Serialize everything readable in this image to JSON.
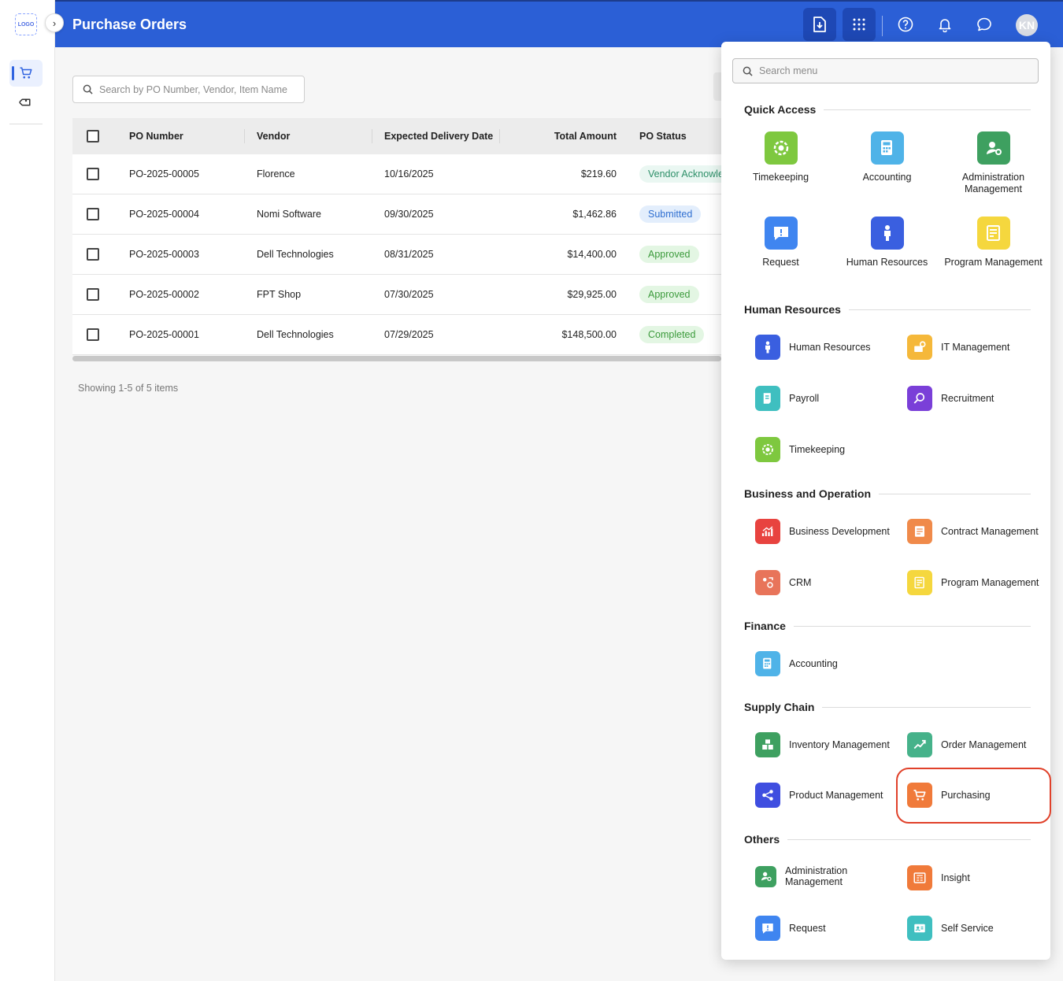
{
  "app": {
    "logo_text": "LOGO",
    "page_title": "Purchase Orders",
    "user_initials": "KN"
  },
  "icons": {
    "cart": "shopping-cart-icon",
    "tag": "tag-icon",
    "download": "download-icon",
    "apps": "apps-grid-icon",
    "help": "help-icon",
    "bell": "bell-icon",
    "chat": "chat-icon",
    "search": "search-icon"
  },
  "colors": {
    "brand_blue": "#2b5fd6",
    "highlight": "#e0412a"
  },
  "search": {
    "placeholder": "Search by PO Number, Vendor, Item Name"
  },
  "table": {
    "headers": {
      "po": "PO Number",
      "vendor": "Vendor",
      "date": "Expected Delivery Date",
      "total": "Total Amount",
      "status": "PO Status"
    },
    "rows": [
      {
        "po": "PO-2025-00005",
        "vendor": "Florence",
        "date": "10/16/2025",
        "total": "$219.60",
        "status": "Vendor Acknowledged"
      },
      {
        "po": "PO-2025-00004",
        "vendor": "Nomi Software",
        "date": "09/30/2025",
        "total": "$1,462.86",
        "status": "Submitted"
      },
      {
        "po": "PO-2025-00003",
        "vendor": "Dell Technologies",
        "date": "08/31/2025",
        "total": "$14,400.00",
        "status": "Approved"
      },
      {
        "po": "PO-2025-00002",
        "vendor": "FPT Shop",
        "date": "07/30/2025",
        "total": "$29,925.00",
        "status": "Approved"
      },
      {
        "po": "PO-2025-00001",
        "vendor": "Dell Technologies",
        "date": "07/29/2025",
        "total": "$148,500.00",
        "status": "Completed"
      }
    ]
  },
  "pagination": {
    "summary": "Showing 1-5 of 5 items"
  },
  "menu": {
    "search_placeholder": "Search menu",
    "sections": {
      "quick": "Quick Access",
      "hr": "Human Resources",
      "biz": "Business and Operation",
      "finance": "Finance",
      "supply": "Supply Chain",
      "others": "Others"
    },
    "quick_access": [
      {
        "label": "Timekeeping",
        "color": "#7ec83f"
      },
      {
        "label": "Accounting",
        "color": "#4fb3e8"
      },
      {
        "label": "Administration Management",
        "color": "#3ea060"
      },
      {
        "label": "Request",
        "color": "#3f85f0"
      },
      {
        "label": "Human Resources",
        "color": "#3a5fe0"
      },
      {
        "label": "Program Management",
        "color": "#f5d73e"
      }
    ],
    "hr": [
      {
        "label": "Human Resources",
        "color": "#3a5fe0"
      },
      {
        "label": "IT Management",
        "color": "#f5b83a"
      },
      {
        "label": "Payroll",
        "color": "#3fbfc0"
      },
      {
        "label": "Recruitment",
        "color": "#7a3fd8"
      },
      {
        "label": "Timekeeping",
        "color": "#7ec83f"
      }
    ],
    "biz": [
      {
        "label": "Business Development",
        "color": "#e8433f"
      },
      {
        "label": "Contract Management",
        "color": "#f08a4a"
      },
      {
        "label": "CRM",
        "color": "#e8745a"
      },
      {
        "label": "Program Management",
        "color": "#f5d73e"
      }
    ],
    "finance": [
      {
        "label": "Accounting",
        "color": "#4fb3e8"
      }
    ],
    "supply": [
      {
        "label": "Inventory Management",
        "color": "#3ea060"
      },
      {
        "label": "Order Management",
        "color": "#46b28a"
      },
      {
        "label": "Product Management",
        "color": "#3f4ee0"
      },
      {
        "label": "Purchasing",
        "color": "#f07a3a"
      }
    ],
    "others": [
      {
        "label": "Administration Management",
        "color": "#3ea060"
      },
      {
        "label": "Insight",
        "color": "#f07a3a"
      },
      {
        "label": "Request",
        "color": "#3f85f0"
      },
      {
        "label": "Self Service",
        "color": "#3fbfc0"
      }
    ]
  }
}
